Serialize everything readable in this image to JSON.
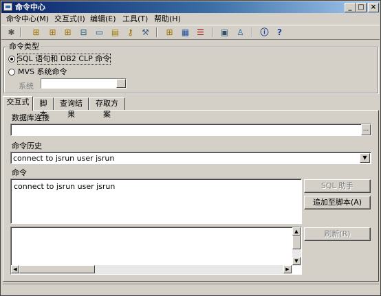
{
  "window": {
    "title": "命令中心",
    "buttons": {
      "minimize": "_",
      "maximize": "□",
      "close": "×"
    }
  },
  "menu": [
    "命令中心(M)",
    "交互式(I)",
    "编辑(E)",
    "工具(T)",
    "帮助(H)"
  ],
  "toolbar": {
    "icons": [
      "gear-icon",
      "tree-icon",
      "tree-icon",
      "tree-icon",
      "tree-icon",
      "computer-icon",
      "document-icon",
      "key-icon",
      "tools-icon",
      "tree-icon",
      "table-icon",
      "list-icon",
      "book-icon",
      "person-icon",
      "info-icon",
      "help-icon"
    ]
  },
  "command_type": {
    "legend": "命令类型",
    "options": [
      {
        "label": "SQL 语句和 DB2 CLP 命令",
        "selected": true
      },
      {
        "label": "MVS 系统命令",
        "selected": false
      }
    ],
    "system_label": "系统"
  },
  "tabs": [
    "交互式",
    "脚本",
    "查询结果",
    "存取方案"
  ],
  "panel": {
    "db_connection_label": "数据库连接",
    "db_connection_value": "",
    "history_label": "命令历史",
    "history_value": "connect to jsrun user jsrun",
    "command_label": "命令",
    "command_value": "connect to jsrun user jsrun",
    "sql_assist_button": "SQL 助手",
    "add_to_script_button": "追加至脚本(A)",
    "refresh_button": "刷新(R)",
    "ellipsis": "..."
  }
}
